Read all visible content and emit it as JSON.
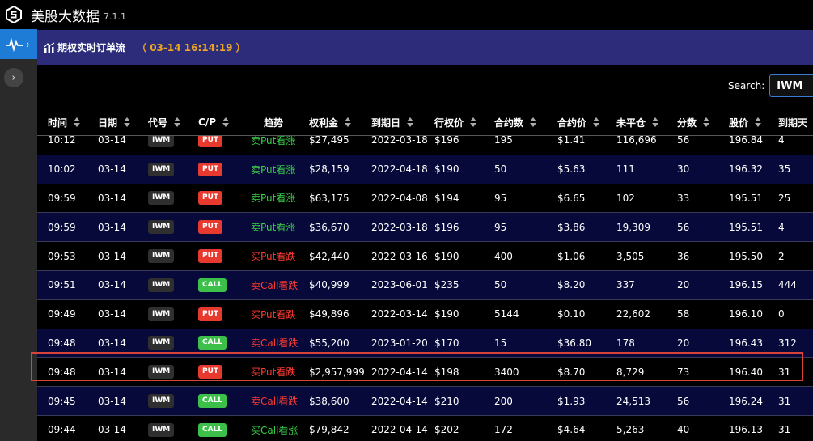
{
  "app": {
    "title": "美股大数据",
    "version": "7.1.1"
  },
  "header": {
    "title": "期权实时订单流",
    "time": "（ 03-14 16:14:19 ）"
  },
  "search": {
    "label": "Search:",
    "value": "IWM"
  },
  "columns": [
    "时间",
    "日期",
    "代号",
    "C/P",
    "趋势",
    "权利金",
    "到期日",
    "行权价",
    "合约数",
    "合约价",
    "未平仓",
    "分数",
    "股价",
    "到期天"
  ],
  "rows": [
    {
      "time": "10:12",
      "date": "03-14",
      "sym": "IWM",
      "cp": "PUT",
      "trend": "卖Put看涨",
      "trend_color": "green",
      "premium": "$27,495",
      "expiry": "2022-03-18",
      "strike": "$196",
      "contracts": "195",
      "price": "$1.41",
      "oi": "116,696",
      "score": "56",
      "stock": "196.84",
      "dte": "4"
    },
    {
      "time": "10:02",
      "date": "03-14",
      "sym": "IWM",
      "cp": "PUT",
      "trend": "卖Put看涨",
      "trend_color": "green",
      "premium": "$28,159",
      "expiry": "2022-04-18",
      "strike": "$190",
      "contracts": "50",
      "price": "$5.63",
      "oi": "111",
      "score": "30",
      "stock": "196.32",
      "dte": "35"
    },
    {
      "time": "09:59",
      "date": "03-14",
      "sym": "IWM",
      "cp": "PUT",
      "trend": "卖Put看涨",
      "trend_color": "green",
      "premium": "$63,175",
      "expiry": "2022-04-08",
      "strike": "$194",
      "contracts": "95",
      "price": "$6.65",
      "oi": "102",
      "score": "33",
      "stock": "195.51",
      "dte": "25"
    },
    {
      "time": "09:59",
      "date": "03-14",
      "sym": "IWM",
      "cp": "PUT",
      "trend": "卖Put看涨",
      "trend_color": "green",
      "premium": "$36,670",
      "expiry": "2022-03-18",
      "strike": "$196",
      "contracts": "95",
      "price": "$3.86",
      "oi": "19,309",
      "score": "56",
      "stock": "195.51",
      "dte": "4"
    },
    {
      "time": "09:53",
      "date": "03-14",
      "sym": "IWM",
      "cp": "PUT",
      "trend": "买Put看跌",
      "trend_color": "red",
      "premium": "$42,440",
      "expiry": "2022-03-16",
      "strike": "$190",
      "contracts": "400",
      "price": "$1.06",
      "oi": "3,505",
      "score": "36",
      "stock": "195.50",
      "dte": "2"
    },
    {
      "time": "09:51",
      "date": "03-14",
      "sym": "IWM",
      "cp": "CALL",
      "trend": "卖Call看跌",
      "trend_color": "red",
      "premium": "$40,999",
      "expiry": "2023-06-01",
      "strike": "$235",
      "contracts": "50",
      "price": "$8.20",
      "oi": "337",
      "score": "20",
      "stock": "196.15",
      "dte": "444"
    },
    {
      "time": "09:49",
      "date": "03-14",
      "sym": "IWM",
      "cp": "PUT",
      "trend": "买Put看跌",
      "trend_color": "red",
      "premium": "$49,896",
      "expiry": "2022-03-14",
      "strike": "$190",
      "contracts": "5144",
      "price": "$0.10",
      "oi": "22,602",
      "score": "58",
      "stock": "196.10",
      "dte": "0"
    },
    {
      "time": "09:48",
      "date": "03-14",
      "sym": "IWM",
      "cp": "CALL",
      "trend": "卖Call看跌",
      "trend_color": "red",
      "premium": "$55,200",
      "expiry": "2023-01-20",
      "strike": "$170",
      "contracts": "15",
      "price": "$36.80",
      "oi": "178",
      "score": "20",
      "stock": "196.43",
      "dte": "312"
    },
    {
      "time": "09:48",
      "date": "03-14",
      "sym": "IWM",
      "cp": "PUT",
      "trend": "买Put看跌",
      "trend_color": "red",
      "premium": "$2,957,999",
      "expiry": "2022-04-14",
      "strike": "$198",
      "contracts": "3400",
      "price": "$8.70",
      "oi": "8,729",
      "score": "73",
      "stock": "196.40",
      "dte": "31"
    },
    {
      "time": "09:45",
      "date": "03-14",
      "sym": "IWM",
      "cp": "CALL",
      "trend": "卖Call看跌",
      "trend_color": "red",
      "premium": "$38,600",
      "expiry": "2022-04-14",
      "strike": "$210",
      "contracts": "200",
      "price": "$1.93",
      "oi": "24,513",
      "score": "56",
      "stock": "196.24",
      "dte": "31"
    },
    {
      "time": "09:44",
      "date": "03-14",
      "sym": "IWM",
      "cp": "CALL",
      "trend": "买Call看涨",
      "trend_color": "green",
      "premium": "$79,842",
      "expiry": "2022-04-14",
      "strike": "$202",
      "contracts": "172",
      "price": "$4.64",
      "oi": "5,263",
      "score": "40",
      "stock": "196.13",
      "dte": "31"
    }
  ],
  "colors": {
    "accent": "#1e7bd6",
    "header_bg": "#2c2c7a",
    "time_orange": "#f0a820",
    "put_red": "#e8392f",
    "call_green": "#3cc04a",
    "highlight": "#d9443a"
  },
  "icons": {
    "logo": "s-logo-icon",
    "rail": "pulse-icon",
    "expand": "chevron-right-icon",
    "header": "chart-icon",
    "sort": "sort-icon"
  }
}
